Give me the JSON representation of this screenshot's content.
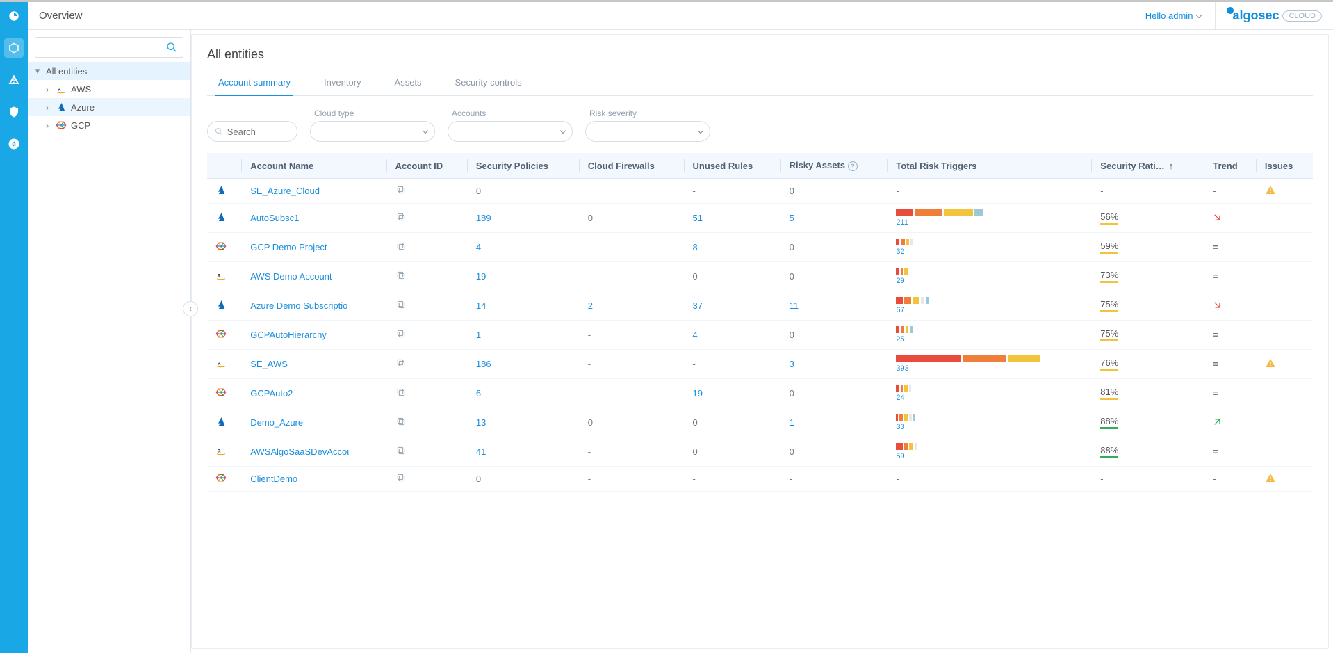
{
  "header": {
    "title": "Overview",
    "hello": "Hello admin",
    "logo_a": "algosec",
    "logo_cloud": "CLOUD"
  },
  "sidebar": {
    "search_placeholder": "",
    "root": "All entities",
    "items": [
      {
        "label": "AWS",
        "cloud": "aws"
      },
      {
        "label": "Azure",
        "cloud": "azure",
        "selected": true
      },
      {
        "label": "GCP",
        "cloud": "gcp"
      }
    ]
  },
  "main": {
    "title": "All entities",
    "tabs": [
      {
        "label": "Account summary",
        "active": true
      },
      {
        "label": "Inventory"
      },
      {
        "label": "Assets"
      },
      {
        "label": "Security controls"
      }
    ],
    "filters": {
      "search_placeholder": "Search",
      "items": [
        "Cloud type",
        "Accounts",
        "Risk severity"
      ]
    },
    "columns": [
      "",
      "Account Name",
      "Account ID",
      "Security Policies",
      "Cloud Firewalls",
      "Unused Rules",
      "Risky Assets",
      "Total Risk Triggers",
      "Security Rati…",
      "Trend",
      "Issues"
    ],
    "rows": [
      {
        "cloud": "azure",
        "name": "SE_Azure_Cloud",
        "policies": "0",
        "policies_link": false,
        "firewalls": "",
        "unused": "-",
        "risky": "0",
        "total": null,
        "rating": "-",
        "rating_color": null,
        "trend": "-",
        "issue": true
      },
      {
        "cloud": "azure",
        "name": "AutoSubsc1",
        "policies": "189",
        "policies_link": true,
        "firewalls": "0",
        "unused": "51",
        "unused_link": true,
        "risky": "5",
        "risky_link": true,
        "total": 211,
        "bars": [
          [
            "#e74c3c",
            25
          ],
          [
            "#ef7e3a",
            40
          ],
          [
            "#f3c33b",
            42
          ],
          [
            "#9ec8d9",
            12
          ]
        ],
        "rating": "56%",
        "rating_color": "mid",
        "trend": "down",
        "issue": false
      },
      {
        "cloud": "gcp",
        "name": "GCP Demo Project",
        "policies": "4",
        "policies_link": true,
        "firewalls": "-",
        "unused": "8",
        "unused_link": true,
        "risky": "0",
        "total": 32,
        "bars": [
          [
            "#e74c3c",
            5
          ],
          [
            "#ef7e3a",
            6
          ],
          [
            "#f3c33b",
            4
          ],
          [
            "#e5e9ee",
            3
          ]
        ],
        "rating": "59%",
        "rating_color": "mid",
        "trend": "eq",
        "issue": false
      },
      {
        "cloud": "aws",
        "name": "AWS Demo Account",
        "policies": "19",
        "policies_link": true,
        "firewalls": "-",
        "unused": "0",
        "risky": "0",
        "total": 29,
        "bars": [
          [
            "#e74c3c",
            5
          ],
          [
            "#ef7e3a",
            3
          ],
          [
            "#f3c33b",
            5
          ]
        ],
        "rating": "73%",
        "rating_color": "mid",
        "trend": "eq",
        "issue": false
      },
      {
        "cloud": "azure",
        "name": "Azure Demo Subscriptiо",
        "policies": "14",
        "policies_link": true,
        "firewalls": "2",
        "firewalls_link": true,
        "unused": "37",
        "unused_link": true,
        "risky": "11",
        "risky_link": true,
        "total": 67,
        "bars": [
          [
            "#e74c3c",
            10
          ],
          [
            "#ef7e3a",
            10
          ],
          [
            "#f3c33b",
            10
          ],
          [
            "#e5e9ee",
            5
          ],
          [
            "#9ec8d9",
            5
          ]
        ],
        "rating": "75%",
        "rating_color": "mid",
        "trend": "down",
        "issue": false
      },
      {
        "cloud": "gcp",
        "name": "GCPAutoHierarchy",
        "policies": "1",
        "policies_link": true,
        "firewalls": "-",
        "unused": "4",
        "unused_link": true,
        "risky": "0",
        "total": 25,
        "bars": [
          [
            "#e74c3c",
            5
          ],
          [
            "#ef7e3a",
            5
          ],
          [
            "#f3c33b",
            4
          ],
          [
            "#9ec8d9",
            4
          ]
        ],
        "rating": "75%",
        "rating_color": "mid",
        "trend": "eq",
        "issue": false
      },
      {
        "cloud": "aws",
        "name": "SE_AWS",
        "policies": "186",
        "policies_link": true,
        "firewalls": "-",
        "unused": "-",
        "risky": "3",
        "risky_link": true,
        "total": 393,
        "bars": [
          [
            "#e74c3c",
            95
          ],
          [
            "#ef7e3a",
            65
          ],
          [
            "#f3c33b",
            48
          ]
        ],
        "rating": "76%",
        "rating_color": "mid",
        "trend": "eq",
        "issue": true
      },
      {
        "cloud": "gcp",
        "name": "GCPAuto2",
        "policies": "6",
        "policies_link": true,
        "firewalls": "-",
        "unused": "19",
        "unused_link": true,
        "risky": "0",
        "total": 24,
        "bars": [
          [
            "#e74c3c",
            5
          ],
          [
            "#ef7e3a",
            3
          ],
          [
            "#f3c33b",
            5
          ],
          [
            "#e5e9ee",
            3
          ]
        ],
        "rating": "81%",
        "rating_color": "mid",
        "trend": "eq",
        "issue": false
      },
      {
        "cloud": "azure",
        "name": "Demo_Azure",
        "policies": "13",
        "policies_link": true,
        "firewalls": "0",
        "unused": "0",
        "risky": "1",
        "risky_link": true,
        "total": 33,
        "bars": [
          [
            "#e74c3c",
            3
          ],
          [
            "#ef7e3a",
            5
          ],
          [
            "#f3c33b",
            5
          ],
          [
            "#e5e9ee",
            4
          ],
          [
            "#9ec8d9",
            3
          ]
        ],
        "rating": "88%",
        "rating_color": "low",
        "trend": "up",
        "issue": false
      },
      {
        "cloud": "aws",
        "name": "AWSAlgoSaaSDevAccoι",
        "policies": "41",
        "policies_link": true,
        "firewalls": "-",
        "unused": "0",
        "risky": "0",
        "total": 59,
        "bars": [
          [
            "#e74c3c",
            10
          ],
          [
            "#ef7e3a",
            5
          ],
          [
            "#f3c33b",
            6
          ],
          [
            "#e5e9ee",
            3
          ]
        ],
        "rating": "88%",
        "rating_color": "low",
        "trend": "eq",
        "issue": false
      },
      {
        "cloud": "gcp",
        "name": "ClientDemo",
        "policies": "0",
        "policies_link": false,
        "firewalls": "-",
        "unused": "-",
        "risky": "-",
        "total": null,
        "rating": "-",
        "rating_color": null,
        "trend": "-",
        "issue": true
      }
    ]
  }
}
